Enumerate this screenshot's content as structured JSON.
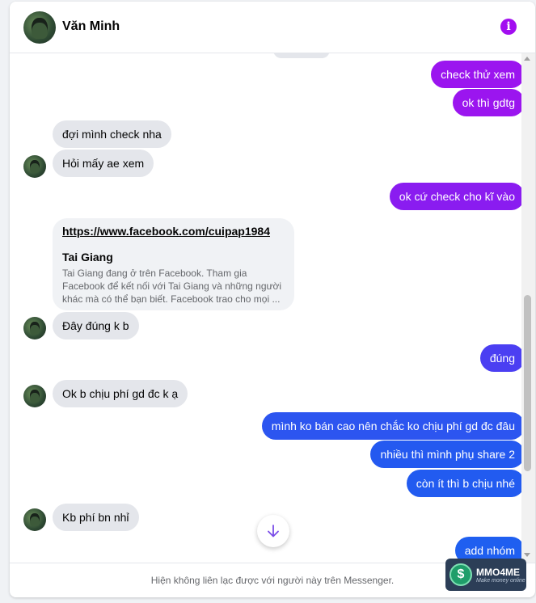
{
  "header": {
    "contact_name": "Văn Minh",
    "info_icon": "info-icon"
  },
  "messages": [
    {
      "side": "out",
      "text": "check thử xem",
      "color": "#9b15ef"
    },
    {
      "side": "out",
      "text": "ok thì gdtg",
      "color": "#9b15ef"
    },
    {
      "side": "in",
      "text": "đợi mình check nha"
    },
    {
      "side": "in",
      "text": "Hỏi mấy ae xem"
    },
    {
      "side": "out",
      "text": "ok cứ check cho kĩ vào",
      "color": "#8a1cf0"
    },
    {
      "side": "in",
      "text": "Đây đúng k b"
    },
    {
      "side": "out",
      "text": "đúng",
      "color": "#4b3ff2"
    },
    {
      "side": "in",
      "text": "Ok b chịu phí gd đc k ạ"
    },
    {
      "side": "out",
      "text": "mình ko bán cao nên chắc ko chịu phí gd đc đâu",
      "color": "#2c55f0"
    },
    {
      "side": "out",
      "text": "nhiều thì mình phụ share 2",
      "color": "#2459f0"
    },
    {
      "side": "out",
      "text": "còn ít thì b chịu nhé",
      "color": "#225bf0"
    },
    {
      "side": "in",
      "text": "Kb phí bn nhỉ"
    },
    {
      "side": "out",
      "text": "add nhóm",
      "color": "#1f5ff0"
    }
  ],
  "link_card": {
    "url": "https://www.facebook.com/cuipap1984",
    "title": "Tai Giang",
    "description": "Tai Giang đang ở trên Facebook. Tham gia Facebook để kết nối với Tai Giang và những người khác mà có thể bạn biết. Facebook trao cho mọi ..."
  },
  "footer": {
    "notice": "Hiện không liên lạc được với người này trên Messenger."
  },
  "watermark": {
    "brand": "MMO4ME",
    "tagline": "Make money online",
    "coin_symbol": "$"
  }
}
